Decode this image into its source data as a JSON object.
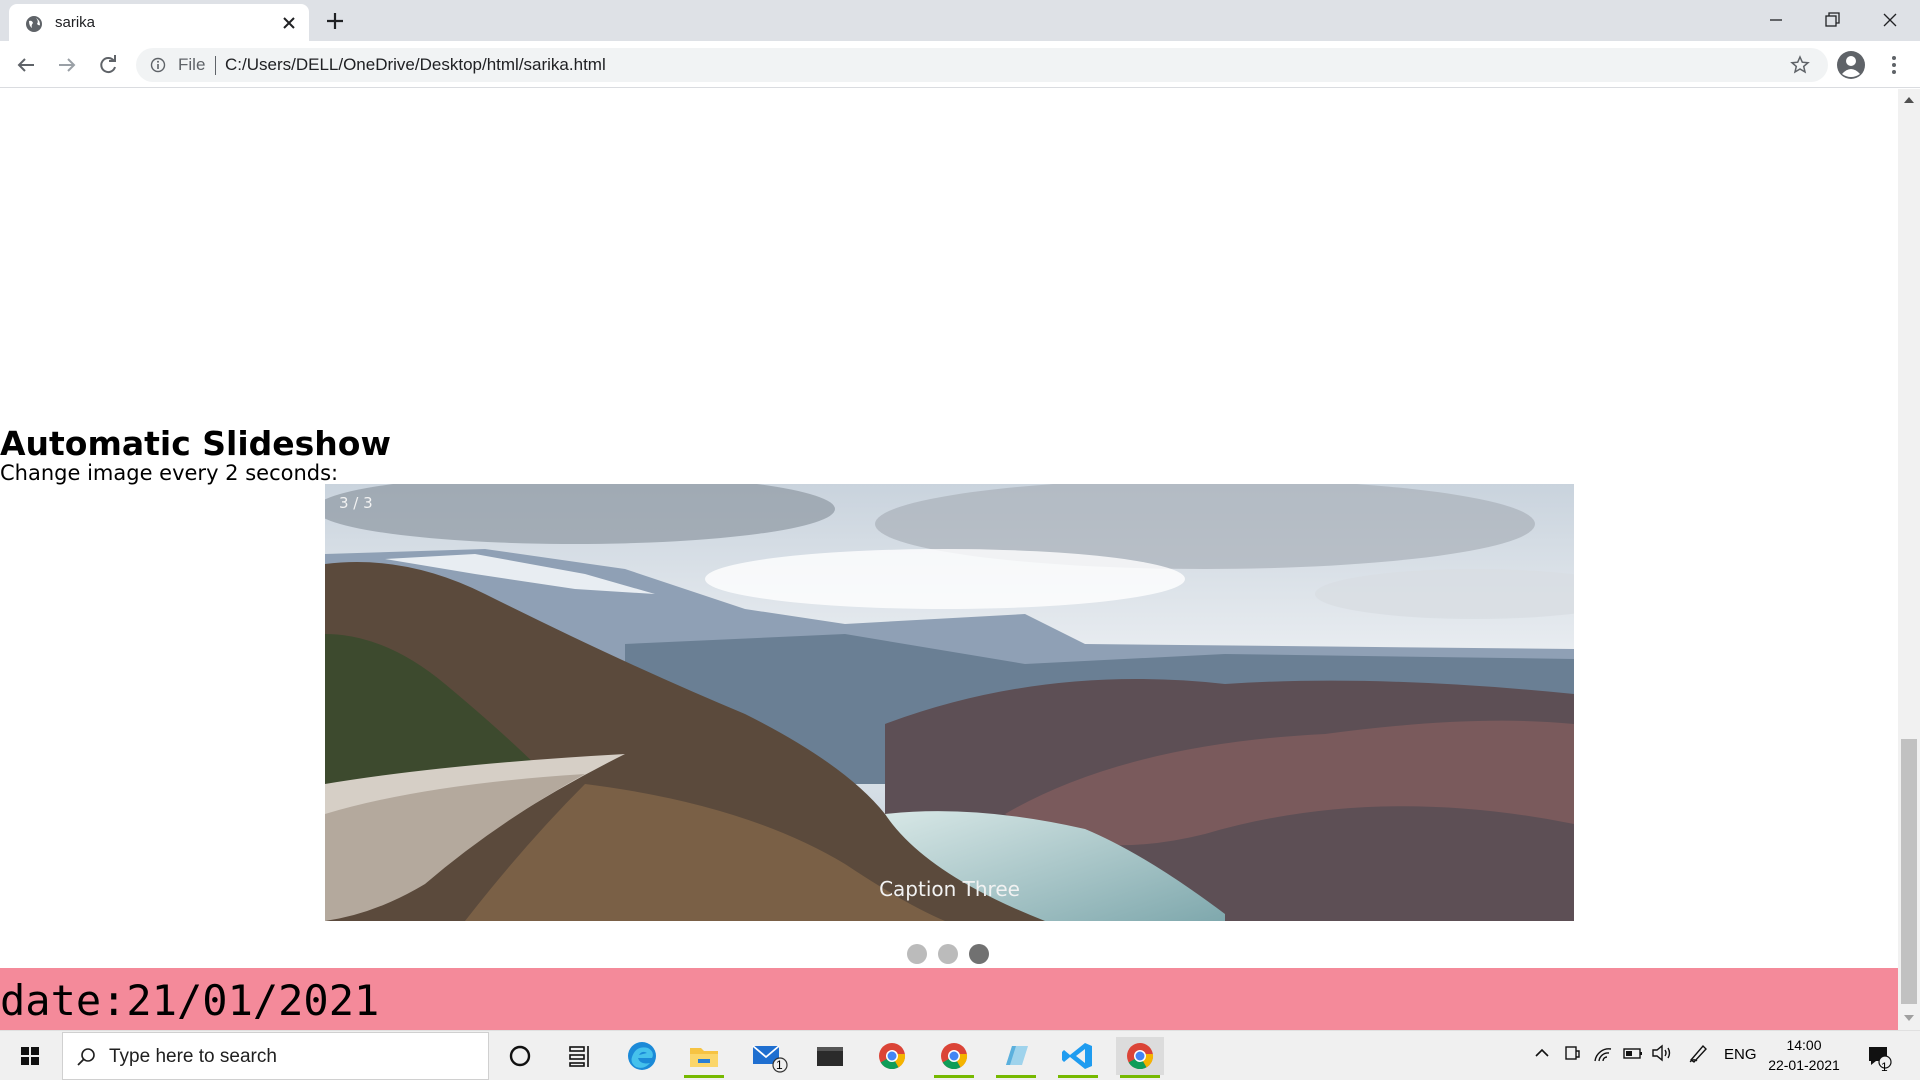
{
  "browser": {
    "tab_title": "sarika",
    "omnibox": {
      "scheme_label": "File",
      "url": "C:/Users/DELL/OneDrive/Desktop/html/sarika.html"
    }
  },
  "page": {
    "heading": "Automatic Slideshow",
    "subtext": "Change image every 2 seconds:",
    "slideshow": {
      "number_text": "3 / 3",
      "caption": "Caption Three",
      "dots": [
        {
          "active": false
        },
        {
          "active": false
        },
        {
          "active": true
        }
      ]
    },
    "footer_text": "date:21/01/2021"
  },
  "taskbar": {
    "search_placeholder": "Type here to search",
    "apps": [
      "cortana-icon",
      "task-view-icon",
      "edge-icon",
      "file-explorer-icon",
      "mail-icon",
      "terminal-icon",
      "chrome-icon",
      "chrome-icon",
      "notepad-icon",
      "vscode-icon",
      "chrome-icon"
    ],
    "mail_badge": "1",
    "language": "ENG",
    "time": "14:00",
    "date": "22-01-2021",
    "notification_count": "1"
  },
  "colors": {
    "footer_bg": "#f48a9a",
    "dot_inactive": "#bbbbbb",
    "dot_active": "#717171"
  }
}
